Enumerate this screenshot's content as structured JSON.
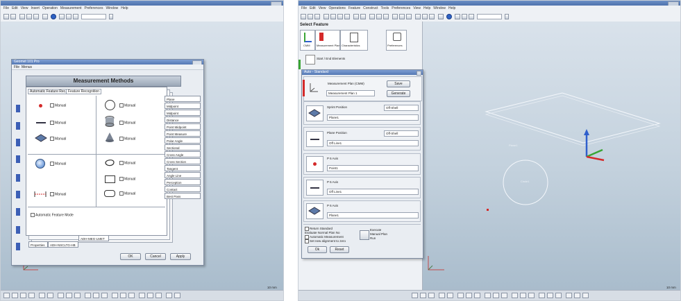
{
  "left": {
    "menubar": [
      "File",
      "Edit",
      "View",
      "Insert",
      "Operation",
      "Measurement",
      "Preferences",
      "Window",
      "Help"
    ],
    "dialog": {
      "title": "Geomet 101 Pro",
      "menu": [
        "File",
        "Menus"
      ],
      "header": "Measurement Methods",
      "tabs": [
        "Automatic Feature Rec.",
        "Feature Recognition"
      ],
      "method_label": "Manual",
      "side_options": [
        "Plane",
        "Midpoint",
        "Midpoint",
        "Distance",
        "Point Midpoint",
        "Point Measure",
        "Polar Angle",
        "Sectional",
        "Cross Angle",
        "Cross Section",
        "Tangent",
        "Angle Line",
        "Perception",
        "Contact",
        "Best Pass"
      ],
      "auto_recognition": "Automatic Feature Mode",
      "bottom_tabs": [
        "Properties",
        "ADH-NSCLTG-HB",
        "ADH-MEG-LMET"
      ],
      "buttons": {
        "ok": "OK",
        "cancel": "Cancel",
        "apply": "Apply"
      }
    },
    "scale_label": "10 mm"
  },
  "right": {
    "menubar": [
      "File",
      "Edit",
      "View",
      "Operations",
      "Feature",
      "Construct",
      "Tools",
      "Preferences",
      "View",
      "Help",
      "Window",
      "Help"
    ],
    "select_feature": "Select Feature",
    "tabs": [
      "CMM",
      "Measurement Plan",
      "Characteristics",
      "Preferences"
    ],
    "tree_item": "Start / End Elements",
    "dialog": {
      "title": "Auto - Standard",
      "plan_label": "Measurement Plan (CMM)",
      "plan_value": "Measurement Plan 1",
      "plan_buttons": {
        "save": "Save",
        "edit": "Generate"
      },
      "rows": [
        {
          "label": "Sprint Position",
          "combo": "Off-Shell",
          "value": "Plane1"
        },
        {
          "label": "Plane Position",
          "combo": "Off-Shell",
          "value": "Off Line1"
        },
        {
          "label": "P 6 Axis",
          "value": "Point1"
        },
        {
          "label": "P 6 Axis",
          "value": "Off Line1"
        },
        {
          "label": "P 6 Axis",
          "value": "Plane1"
        }
      ],
      "footer_checks": [
        "Return Standard",
        "Evaluate Normal Plan No",
        "Automatic Measurement",
        "Set new alignment to zero"
      ],
      "footer_execute": [
        "Execute",
        "Manual Plan",
        "Run"
      ],
      "buttons": {
        "ok": "Ok",
        "reset": "Reset"
      }
    },
    "plane_label": "Plane1",
    "circle_label": "Circle1",
    "scale_label": "10 mm"
  },
  "colors": {
    "accent": "#4e72ad",
    "red": "#d42a2a",
    "axis_green": "#3aa534",
    "axis_blue": "#2f5fcc"
  }
}
